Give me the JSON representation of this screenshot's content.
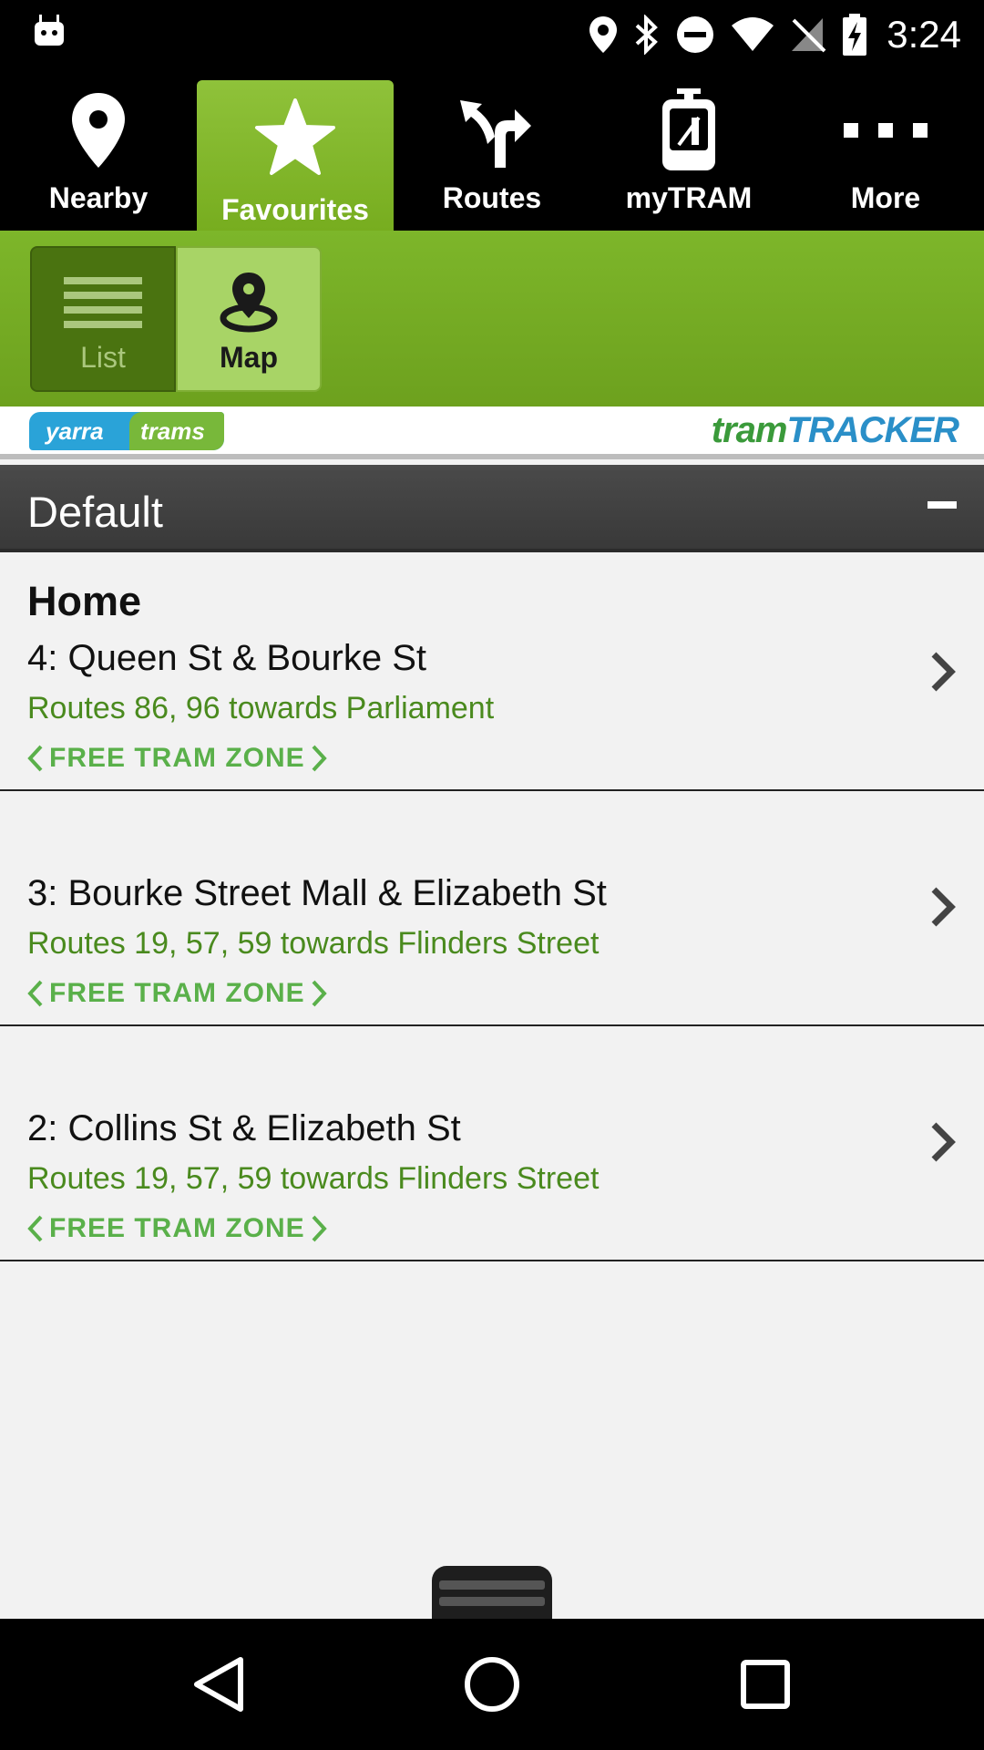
{
  "status_bar": {
    "time": "3:24",
    "icons": [
      "android-icon",
      "location-icon",
      "bluetooth-icon",
      "dnd-icon",
      "wifi-icon",
      "no-sim-icon",
      "battery-charging-icon"
    ]
  },
  "tabs": [
    {
      "label": "Nearby",
      "icon": "location-pin-icon",
      "active": false
    },
    {
      "label": "Favourites",
      "icon": "star-icon",
      "active": true
    },
    {
      "label": "Routes",
      "icon": "route-arrows-icon",
      "active": false
    },
    {
      "label": "myTRAM",
      "icon": "tram-icon",
      "active": false
    },
    {
      "label": "More",
      "icon": "more-dots-icon",
      "active": false
    }
  ],
  "view_toggle": {
    "list_label": "List",
    "map_label": "Map",
    "selected": "List"
  },
  "brand": {
    "yarra_left": "yarra",
    "yarra_right": "trams",
    "tt_prefix": "tram",
    "tt_suffix": "TRACKER"
  },
  "group": {
    "title": "Default"
  },
  "favourites": [
    {
      "name": "Home",
      "stop": "4: Queen St & Bourke St",
      "routes": "Routes 86, 96 towards Parliament",
      "zone": "FREE TRAM ZONE"
    },
    {
      "name": "",
      "stop": "3: Bourke Street Mall & Elizabeth St",
      "routes": "Routes 19, 57, 59 towards Flinders Street",
      "zone": "FREE TRAM ZONE"
    },
    {
      "name": "",
      "stop": "2: Collins St & Elizabeth St",
      "routes": "Routes 19, 57, 59 towards Flinders Street",
      "zone": "FREE TRAM ZONE"
    }
  ],
  "colors": {
    "accent_green": "#7db62a",
    "route_text": "#4a8a1e",
    "zone_text": "#5ab04a"
  }
}
